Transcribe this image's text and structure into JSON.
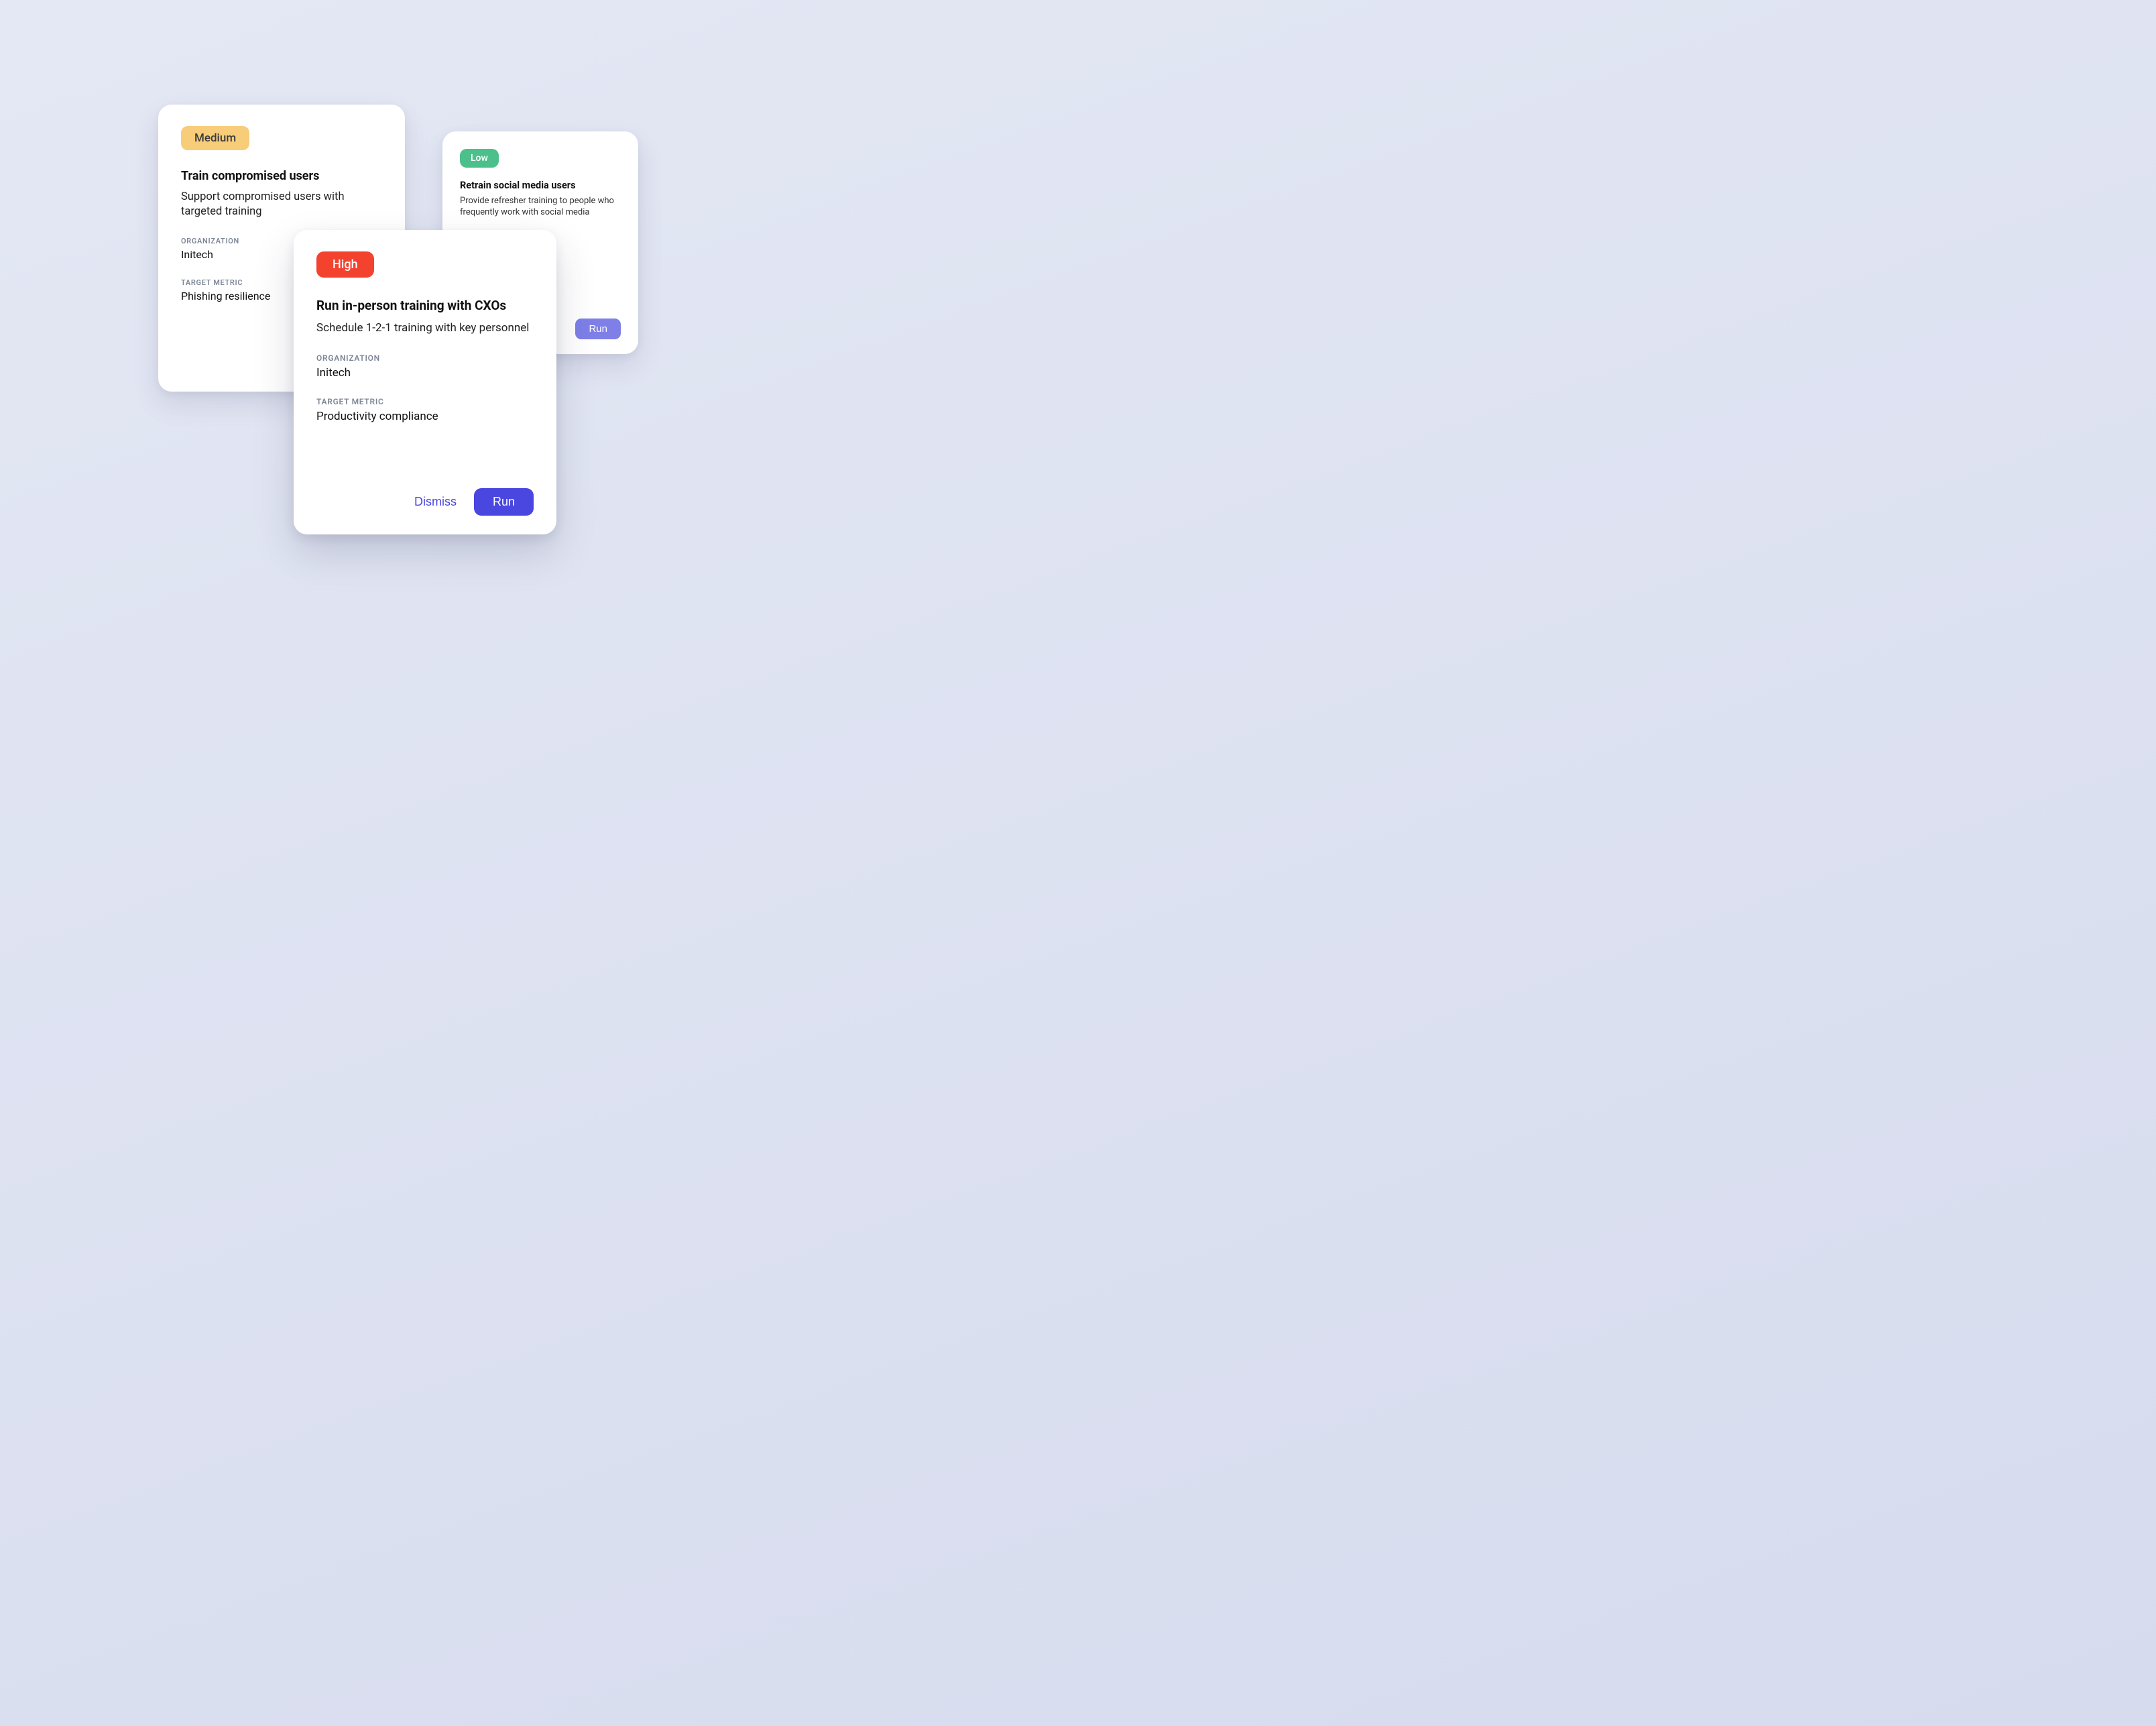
{
  "labels": {
    "organization": "ORGANIZATION",
    "target_metric": "TARGET METRIC",
    "dismiss": "Dismiss",
    "run": "Run"
  },
  "priority": {
    "high": "High",
    "medium": "Medium",
    "low": "Low"
  },
  "cards": {
    "medium": {
      "title": "Train compromised users",
      "description": "Support compromised users with targeted training",
      "organization": "Initech",
      "target_metric": "Phishing resilience"
    },
    "low": {
      "title": "Retrain social media users",
      "description": "Provide refresher training to people who frequently work with social media"
    },
    "high": {
      "title": "Run in-person training with CXOs",
      "description": "Schedule 1-2-1 training with key personnel",
      "organization": "Initech",
      "target_metric": "Productivity compliance"
    }
  },
  "colors": {
    "accent_primary": "#4a46e0",
    "badge_high": "#f3432f",
    "badge_medium": "#f7cd7a",
    "badge_low": "#4bc08b"
  }
}
